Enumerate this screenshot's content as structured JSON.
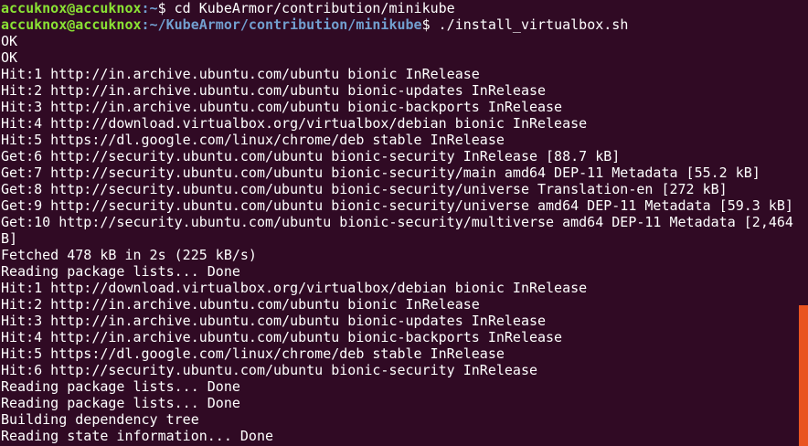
{
  "terminal": {
    "prompt_user_host": "accuknox@accuknox",
    "commands": [
      {
        "path": "~",
        "suffix": "$ ",
        "command": "cd KubeArmor/contribution/minikube"
      },
      {
        "path": "~/KubeArmor/contribution/minikube",
        "suffix": "$ ",
        "command": "./install_virtualbox.sh"
      }
    ],
    "prompt_1_path_display": ":~",
    "prompt_2_path_display": ":~/KubeArmor/contribution/minikube",
    "output_lines": [
      "OK",
      "OK",
      "Hit:1 http://in.archive.ubuntu.com/ubuntu bionic InRelease",
      "Hit:2 http://in.archive.ubuntu.com/ubuntu bionic-updates InRelease",
      "Hit:3 http://in.archive.ubuntu.com/ubuntu bionic-backports InRelease",
      "Hit:4 http://download.virtualbox.org/virtualbox/debian bionic InRelease",
      "Hit:5 https://dl.google.com/linux/chrome/deb stable InRelease",
      "Get:6 http://security.ubuntu.com/ubuntu bionic-security InRelease [88.7 kB]",
      "Get:7 http://security.ubuntu.com/ubuntu bionic-security/main amd64 DEP-11 Metadata [55.2 kB]",
      "Get:8 http://security.ubuntu.com/ubuntu bionic-security/universe Translation-en [272 kB]",
      "Get:9 http://security.ubuntu.com/ubuntu bionic-security/universe amd64 DEP-11 Metadata [59.3 kB]",
      "Get:10 http://security.ubuntu.com/ubuntu bionic-security/multiverse amd64 DEP-11 Metadata [2,464",
      "B]",
      "Fetched 478 kB in 2s (225 kB/s)",
      "Reading package lists... Done",
      "Hit:1 http://download.virtualbox.org/virtualbox/debian bionic InRelease",
      "Hit:2 http://in.archive.ubuntu.com/ubuntu bionic InRelease",
      "Hit:3 http://in.archive.ubuntu.com/ubuntu bionic-updates InRelease",
      "Hit:4 http://in.archive.ubuntu.com/ubuntu bionic-backports InRelease",
      "Hit:5 https://dl.google.com/linux/chrome/deb stable InRelease",
      "Hit:6 http://security.ubuntu.com/ubuntu bionic-security InRelease",
      "Reading package lists... Done",
      "Reading package lists... Done",
      "Building dependency tree",
      "Reading state information... Done"
    ]
  },
  "colors": {
    "background": "#300a24",
    "text": "#ffffff",
    "user_host": "#8ae234",
    "path": "#729fcf",
    "scrollbar_thumb": "#e95420"
  },
  "scrollbar": {
    "position_fraction": 1.0,
    "visible_fraction": 0.32
  }
}
